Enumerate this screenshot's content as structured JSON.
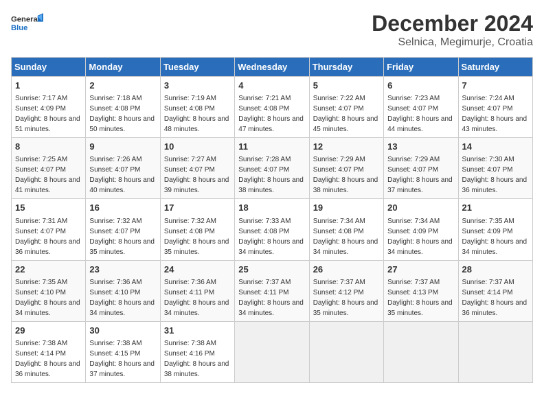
{
  "header": {
    "logo_line1": "General",
    "logo_line2": "Blue",
    "month": "December 2024",
    "location": "Selnica, Megimurje, Croatia"
  },
  "days_of_week": [
    "Sunday",
    "Monday",
    "Tuesday",
    "Wednesday",
    "Thursday",
    "Friday",
    "Saturday"
  ],
  "weeks": [
    [
      {
        "day": 1,
        "sunrise": "7:17 AM",
        "sunset": "4:09 PM",
        "daylight": "8 hours and 51 minutes."
      },
      {
        "day": 2,
        "sunrise": "7:18 AM",
        "sunset": "4:08 PM",
        "daylight": "8 hours and 50 minutes."
      },
      {
        "day": 3,
        "sunrise": "7:19 AM",
        "sunset": "4:08 PM",
        "daylight": "8 hours and 48 minutes."
      },
      {
        "day": 4,
        "sunrise": "7:21 AM",
        "sunset": "4:08 PM",
        "daylight": "8 hours and 47 minutes."
      },
      {
        "day": 5,
        "sunrise": "7:22 AM",
        "sunset": "4:07 PM",
        "daylight": "8 hours and 45 minutes."
      },
      {
        "day": 6,
        "sunrise": "7:23 AM",
        "sunset": "4:07 PM",
        "daylight": "8 hours and 44 minutes."
      },
      {
        "day": 7,
        "sunrise": "7:24 AM",
        "sunset": "4:07 PM",
        "daylight": "8 hours and 43 minutes."
      }
    ],
    [
      {
        "day": 8,
        "sunrise": "7:25 AM",
        "sunset": "4:07 PM",
        "daylight": "8 hours and 41 minutes."
      },
      {
        "day": 9,
        "sunrise": "7:26 AM",
        "sunset": "4:07 PM",
        "daylight": "8 hours and 40 minutes."
      },
      {
        "day": 10,
        "sunrise": "7:27 AM",
        "sunset": "4:07 PM",
        "daylight": "8 hours and 39 minutes."
      },
      {
        "day": 11,
        "sunrise": "7:28 AM",
        "sunset": "4:07 PM",
        "daylight": "8 hours and 38 minutes."
      },
      {
        "day": 12,
        "sunrise": "7:29 AM",
        "sunset": "4:07 PM",
        "daylight": "8 hours and 38 minutes."
      },
      {
        "day": 13,
        "sunrise": "7:29 AM",
        "sunset": "4:07 PM",
        "daylight": "8 hours and 37 minutes."
      },
      {
        "day": 14,
        "sunrise": "7:30 AM",
        "sunset": "4:07 PM",
        "daylight": "8 hours and 36 minutes."
      }
    ],
    [
      {
        "day": 15,
        "sunrise": "7:31 AM",
        "sunset": "4:07 PM",
        "daylight": "8 hours and 36 minutes."
      },
      {
        "day": 16,
        "sunrise": "7:32 AM",
        "sunset": "4:07 PM",
        "daylight": "8 hours and 35 minutes."
      },
      {
        "day": 17,
        "sunrise": "7:32 AM",
        "sunset": "4:08 PM",
        "daylight": "8 hours and 35 minutes."
      },
      {
        "day": 18,
        "sunrise": "7:33 AM",
        "sunset": "4:08 PM",
        "daylight": "8 hours and 34 minutes."
      },
      {
        "day": 19,
        "sunrise": "7:34 AM",
        "sunset": "4:08 PM",
        "daylight": "8 hours and 34 minutes."
      },
      {
        "day": 20,
        "sunrise": "7:34 AM",
        "sunset": "4:09 PM",
        "daylight": "8 hours and 34 minutes."
      },
      {
        "day": 21,
        "sunrise": "7:35 AM",
        "sunset": "4:09 PM",
        "daylight": "8 hours and 34 minutes."
      }
    ],
    [
      {
        "day": 22,
        "sunrise": "7:35 AM",
        "sunset": "4:10 PM",
        "daylight": "8 hours and 34 minutes."
      },
      {
        "day": 23,
        "sunrise": "7:36 AM",
        "sunset": "4:10 PM",
        "daylight": "8 hours and 34 minutes."
      },
      {
        "day": 24,
        "sunrise": "7:36 AM",
        "sunset": "4:11 PM",
        "daylight": "8 hours and 34 minutes."
      },
      {
        "day": 25,
        "sunrise": "7:37 AM",
        "sunset": "4:11 PM",
        "daylight": "8 hours and 34 minutes."
      },
      {
        "day": 26,
        "sunrise": "7:37 AM",
        "sunset": "4:12 PM",
        "daylight": "8 hours and 35 minutes."
      },
      {
        "day": 27,
        "sunrise": "7:37 AM",
        "sunset": "4:13 PM",
        "daylight": "8 hours and 35 minutes."
      },
      {
        "day": 28,
        "sunrise": "7:37 AM",
        "sunset": "4:14 PM",
        "daylight": "8 hours and 36 minutes."
      }
    ],
    [
      {
        "day": 29,
        "sunrise": "7:38 AM",
        "sunset": "4:14 PM",
        "daylight": "8 hours and 36 minutes."
      },
      {
        "day": 30,
        "sunrise": "7:38 AM",
        "sunset": "4:15 PM",
        "daylight": "8 hours and 37 minutes."
      },
      {
        "day": 31,
        "sunrise": "7:38 AM",
        "sunset": "4:16 PM",
        "daylight": "8 hours and 38 minutes."
      },
      null,
      null,
      null,
      null
    ]
  ]
}
